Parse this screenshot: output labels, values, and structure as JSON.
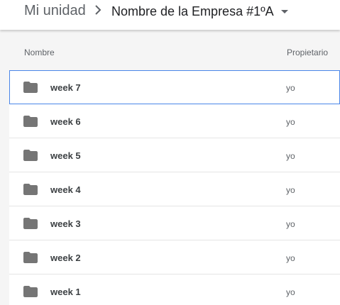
{
  "breadcrumb": {
    "root_label": "Mi unidad",
    "separator_icon": "chevron-right-icon",
    "current_label": "Nombre de la Empresa #1ºA",
    "dropdown_icon": "caret-down-icon"
  },
  "table": {
    "columns": {
      "name": "Nombre",
      "owner": "Propietario"
    },
    "rows": [
      {
        "name": "week 7",
        "owner": "yo",
        "icon": "folder-icon",
        "selected": true
      },
      {
        "name": "week 6",
        "owner": "yo",
        "icon": "folder-icon"
      },
      {
        "name": "week 5",
        "owner": "yo",
        "icon": "folder-icon"
      },
      {
        "name": "week 4",
        "owner": "yo",
        "icon": "folder-icon"
      },
      {
        "name": "week 3",
        "owner": "yo",
        "icon": "folder-icon"
      },
      {
        "name": "week 2",
        "owner": "yo",
        "icon": "folder-icon"
      },
      {
        "name": "week 1",
        "owner": "yo",
        "icon": "folder-icon"
      }
    ]
  },
  "colors": {
    "folder_icon": "#757575",
    "selection_border": "#4a86e8",
    "list_background": "#f5f5f5"
  }
}
